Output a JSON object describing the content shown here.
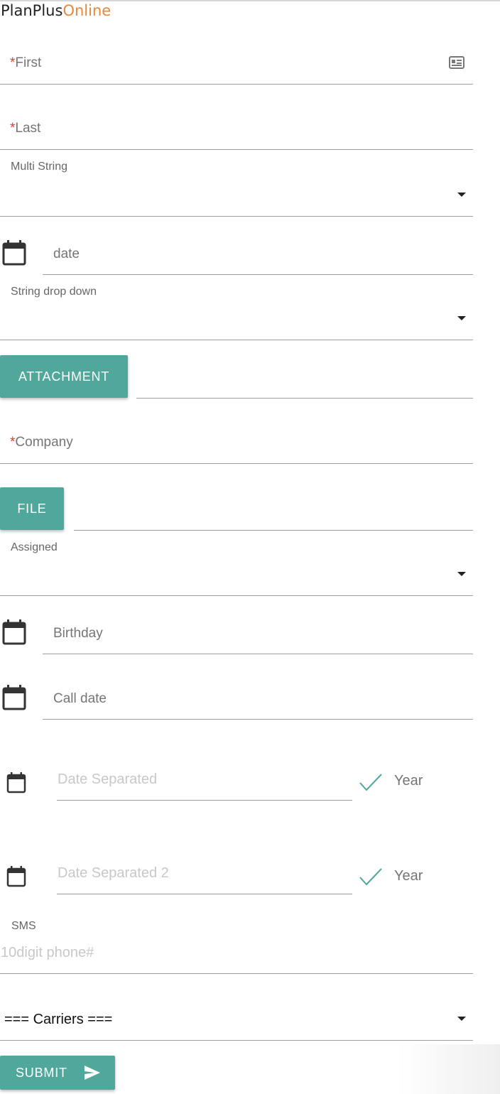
{
  "brand": {
    "part1": "PlanPlus",
    "part2": "Online"
  },
  "form": {
    "first": {
      "required_mark": "*",
      "label": "First",
      "icon": "contact-card-icon"
    },
    "last": {
      "required_mark": "*",
      "label": "Last"
    },
    "multi_string": {
      "label": "Multi String",
      "value": ""
    },
    "date": {
      "label": "date",
      "icon": "calendar-icon"
    },
    "string_drop_down": {
      "label": "String drop down",
      "value": ""
    },
    "attachment": {
      "button_label": "ATTACHMENT",
      "file_name": ""
    },
    "company": {
      "required_mark": "*",
      "label": "Company"
    },
    "file": {
      "button_label": "FILE",
      "file_name": ""
    },
    "assigned": {
      "label": "Assigned",
      "value": ""
    },
    "birthday": {
      "label": "Birthday",
      "icon": "calendar-icon"
    },
    "call_date": {
      "label": "Call date",
      "icon": "calendar-icon"
    },
    "date_separated": {
      "placeholder": "Date Separated",
      "check_label": "Year",
      "checked": true
    },
    "date_separated_2": {
      "placeholder": "Date Separated 2",
      "check_label": "Year",
      "checked": true
    },
    "sms": {
      "label": "SMS",
      "placeholder": "10digit phone#"
    },
    "carriers": {
      "selected": "=== Carriers ==="
    },
    "submit": {
      "label": "SUBMIT",
      "icon": "send-icon"
    }
  },
  "colors": {
    "accent": "#4fa89b",
    "brand_orange": "#e8873a",
    "required": "#e53935"
  }
}
